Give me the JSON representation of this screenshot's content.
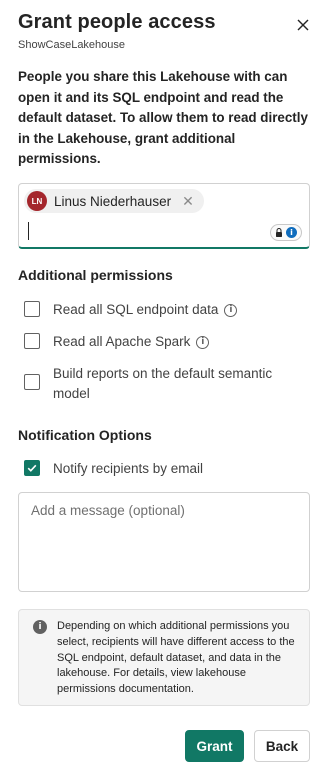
{
  "dialog": {
    "title": "Grant people access",
    "subtitle": "ShowCaseLakehouse",
    "close_icon": "close-icon",
    "description": "People you share this Lakehouse with can open it and its SQL endpoint and read the default dataset. To allow them to read directly in the Lakehouse, grant additional permissions."
  },
  "people_picker": {
    "selected": [
      {
        "initials": "LN",
        "name": "Linus Niederhauser",
        "avatar_color": "#a4262c"
      }
    ],
    "input_value": ""
  },
  "additional_permissions": {
    "heading": "Additional permissions",
    "options": [
      {
        "label": "Read all SQL endpoint data",
        "checked": false,
        "has_info": true
      },
      {
        "label": "Read all Apache Spark",
        "checked": false,
        "has_info": true
      },
      {
        "label": "Build reports on the default semantic model",
        "checked": false,
        "has_info": false
      }
    ]
  },
  "notification": {
    "heading": "Notification Options",
    "notify_label": "Notify recipients by email",
    "notify_checked": true,
    "message_placeholder": "Add a message (optional)"
  },
  "info_box": {
    "text": "Depending on which additional permissions you select, recipients will have different access to the SQL endpoint, default dataset, and data in the lakehouse. For details, view lakehouse permissions documentation."
  },
  "actions": {
    "grant_label": "Grant",
    "back_label": "Back"
  },
  "colors": {
    "accent": "#117865",
    "avatar": "#a4262c"
  }
}
